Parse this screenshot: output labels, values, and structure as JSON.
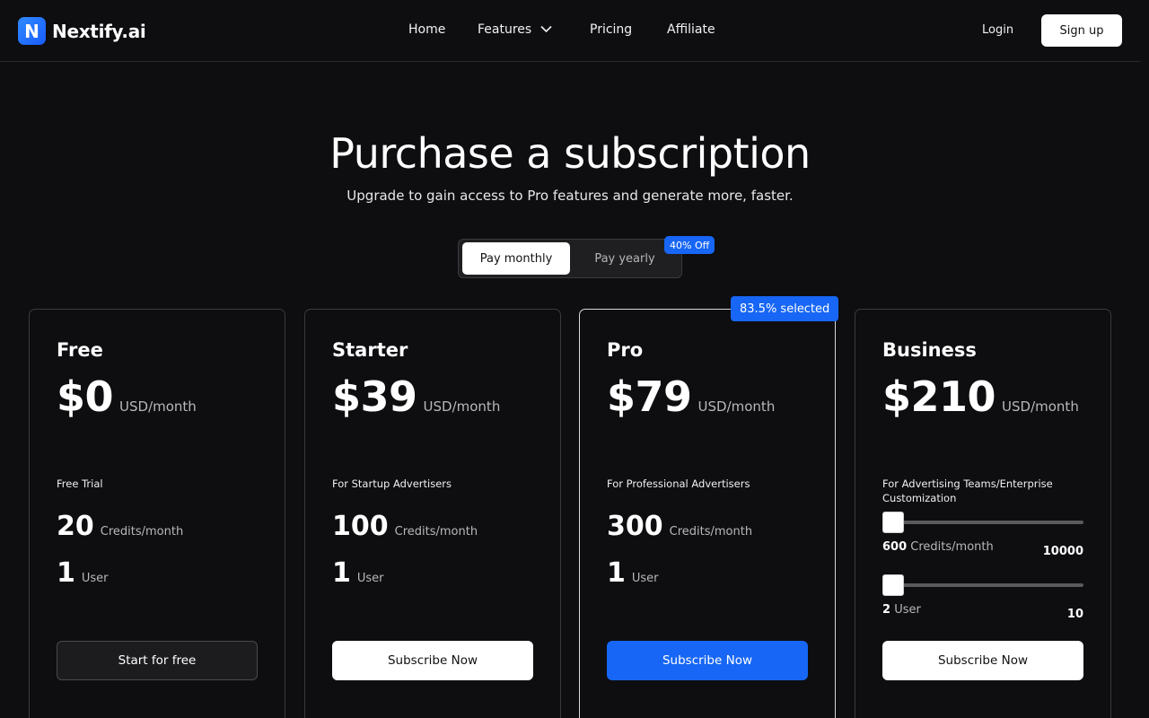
{
  "nav": {
    "logo_letter": "N",
    "brand": "Nextify.ai",
    "links": [
      "Home",
      "Features",
      "Pricing",
      "Affiliate"
    ],
    "login": "Login",
    "signup": "Sign up"
  },
  "hero": {
    "title": "Purchase a subscription",
    "subtitle": "Upgrade to gain access to Pro features and generate more, faster."
  },
  "billing_toggle": {
    "monthly": "Pay monthly",
    "yearly": "Pay yearly",
    "discount": "40% Off",
    "selected": "monthly"
  },
  "selected_badge": "83.5% selected",
  "plans": [
    {
      "name": "Free",
      "price": "$0",
      "unit": "USD/month",
      "audience": "Free Trial",
      "credits": "20",
      "credits_unit": "Credits/month",
      "users": "1",
      "users_unit": "User",
      "cta": "Start for free"
    },
    {
      "name": "Starter",
      "price": "$39",
      "unit": "USD/month",
      "audience": "For Startup Advertisers",
      "credits": "100",
      "credits_unit": "Credits/month",
      "users": "1",
      "users_unit": "User",
      "cta": "Subscribe Now"
    },
    {
      "name": "Pro",
      "price": "$79",
      "unit": "USD/month",
      "audience": "For Professional Advertisers",
      "credits": "300",
      "credits_unit": "Credits/month",
      "users": "1",
      "users_unit": "User",
      "cta": "Subscribe Now"
    },
    {
      "name": "Business",
      "price": "$210",
      "unit": "USD/month",
      "audience": "For Advertising Teams/Enterprise Customization",
      "credits_value": "600",
      "credits_unit": "Credits/month",
      "credits_max": "10000",
      "users_value": "2",
      "users_unit": "User",
      "users_max": "10",
      "cta": "Subscribe Now"
    }
  ],
  "colors": {
    "background": "#0e0d10",
    "accent": "#1766f5",
    "card_border": "#3a3a3e"
  }
}
